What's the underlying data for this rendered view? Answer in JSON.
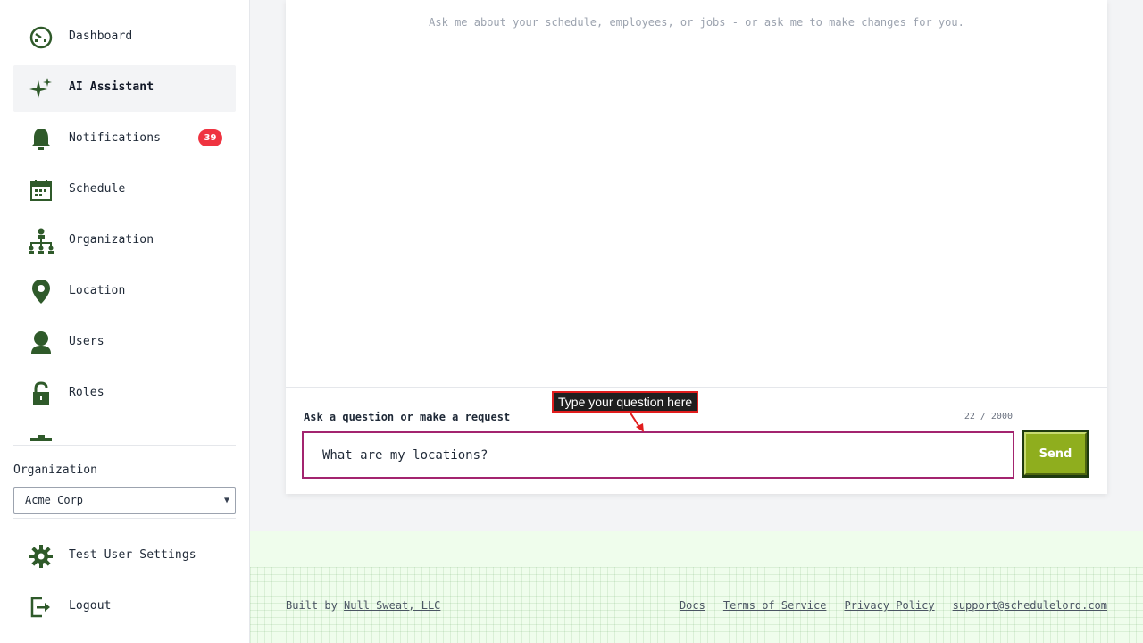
{
  "sidebar": {
    "items": [
      {
        "label": "Dashboard",
        "icon": "dashboard-icon"
      },
      {
        "label": "AI Assistant",
        "icon": "sparkle-icon",
        "active": true
      },
      {
        "label": "Notifications",
        "icon": "bell-icon",
        "badge": "39"
      },
      {
        "label": "Schedule",
        "icon": "calendar-icon"
      },
      {
        "label": "Organization",
        "icon": "org-chart-icon"
      },
      {
        "label": "Location",
        "icon": "map-pin-icon"
      },
      {
        "label": "Users",
        "icon": "user-icon"
      },
      {
        "label": "Roles",
        "icon": "lock-icon"
      }
    ],
    "organization_label": "Organization",
    "organization_selected": "Acme Corp",
    "bottom": [
      {
        "label": "Test User Settings",
        "icon": "gear-icon"
      },
      {
        "label": "Logout",
        "icon": "logout-icon"
      }
    ]
  },
  "main": {
    "hint": "Ask me about your schedule, employees, or jobs - or ask me to make changes for you.",
    "input_label": "Ask a question or make a request",
    "char_count": "22 / 2000",
    "input_value": "What are my locations?",
    "send_label": "Send"
  },
  "annotation": {
    "text": "Type your question here"
  },
  "footer": {
    "built_by": "Built by",
    "company": "Null Sweat, LLC",
    "links": [
      "Docs",
      "Terms of Service",
      "Privacy Policy",
      "support@schedulelord.com"
    ]
  },
  "colors": {
    "icon_green": "#2f5a2a",
    "badge_red": "#ef3340",
    "input_border": "#a3246f",
    "send_green": "#8fae1e"
  }
}
